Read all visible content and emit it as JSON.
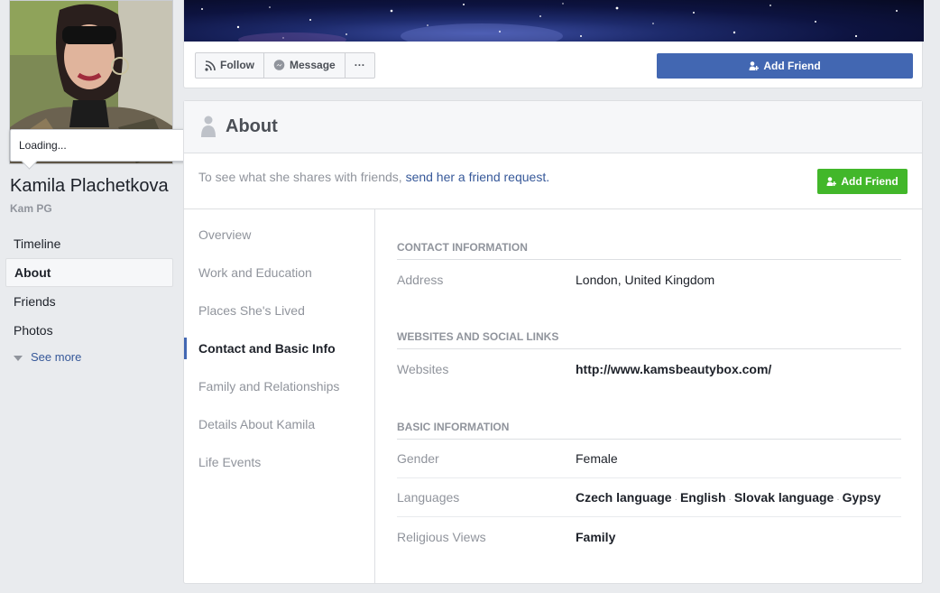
{
  "tooltip": {
    "text": "Loading..."
  },
  "profile": {
    "name": "Kamila Plachetkova",
    "alternate_name": "Kam PG"
  },
  "left_nav": {
    "items": [
      {
        "label": "Timeline"
      },
      {
        "label": "About"
      },
      {
        "label": "Friends"
      },
      {
        "label": "Photos"
      }
    ],
    "see_more": "See more"
  },
  "actions": {
    "follow": "Follow",
    "message": "Message",
    "more": "···",
    "add_friend": "Add Friend"
  },
  "about": {
    "title": "About",
    "notice_prefix": "To see what she shares with friends, ",
    "notice_link": "send her a friend request.",
    "add_friend": "Add Friend",
    "nav": [
      {
        "label": "Overview"
      },
      {
        "label": "Work and Education"
      },
      {
        "label": "Places She's Lived"
      },
      {
        "label": "Contact and Basic Info"
      },
      {
        "label": "Family and Relationships"
      },
      {
        "label": "Details About Kamila"
      },
      {
        "label": "Life Events"
      }
    ],
    "contact": {
      "title": "CONTACT INFORMATION",
      "address_label": "Address",
      "address_value": "London, United Kingdom"
    },
    "websites": {
      "title": "WEBSITES AND SOCIAL LINKS",
      "label": "Websites",
      "value": "http://www.kamsbeautybox.com/"
    },
    "basic": {
      "title": "BASIC INFORMATION",
      "gender_label": "Gender",
      "gender_value": "Female",
      "languages_label": "Languages",
      "languages": [
        "Czech language",
        "English",
        "Slovak language",
        "Gypsy"
      ],
      "religious_label": "Religious Views",
      "religious_value": "Family"
    }
  },
  "colors": {
    "primary_blue": "#4267b2",
    "green": "#42b72a",
    "link": "#365899",
    "muted": "#90949c",
    "background": "#e9ebee"
  }
}
